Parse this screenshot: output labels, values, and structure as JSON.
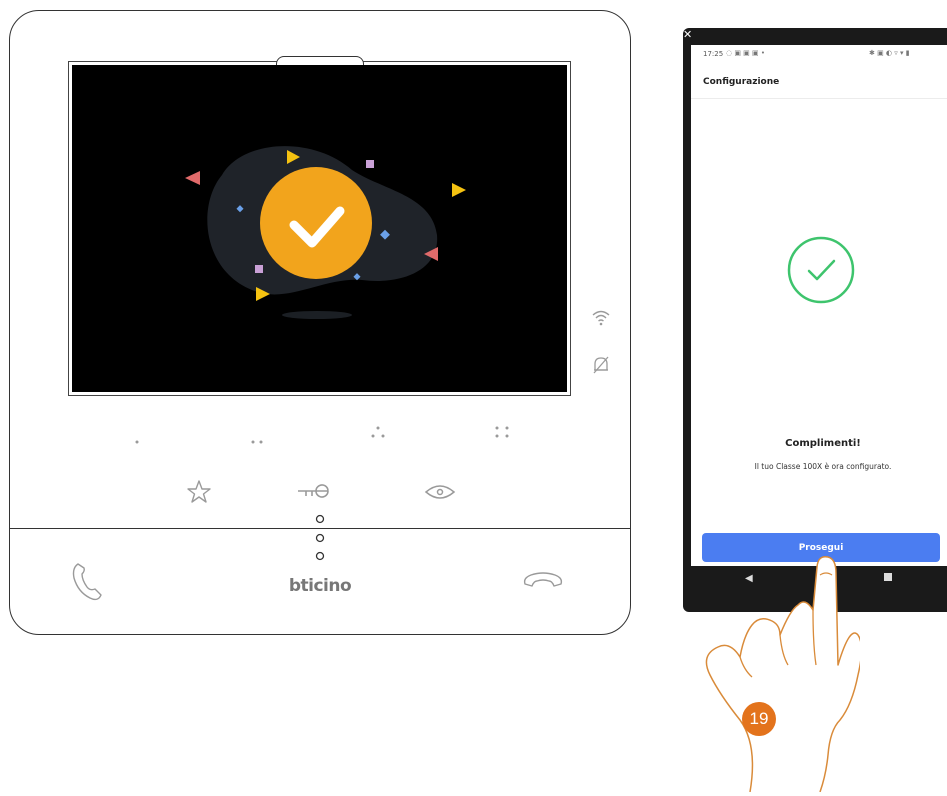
{
  "intercom": {
    "brand": "bticino",
    "screen": {
      "state": "success",
      "icon": "checkmark-icon"
    },
    "side_icons": [
      "wifi-icon",
      "bell-off-icon"
    ],
    "shortcut_dots": [
      "1-dot",
      "2-dots",
      "3-dots",
      "4-dots"
    ],
    "buttons": [
      "star-icon",
      "key-icon",
      "eye-icon"
    ],
    "bottom_buttons": [
      "answer-phone-icon",
      "hang-up-icon"
    ]
  },
  "phone": {
    "status_bar": {
      "time": "17:25"
    },
    "app_bar": {
      "title": "Configurazione"
    },
    "success": {
      "title": "Complimenti!",
      "message": "Il tuo Classe 100X è ora configurato."
    },
    "primary_button": {
      "label": "Prosegui"
    },
    "nav": [
      "back-icon",
      "home-icon",
      "recents-icon"
    ]
  },
  "step": {
    "number": "19"
  },
  "colors": {
    "button_blue": "#4b7df1",
    "success_green": "#3ec46d",
    "badge_orange": "#e3731c",
    "check_orange": "#f2a41c",
    "hand_outline": "#d98b3a"
  }
}
